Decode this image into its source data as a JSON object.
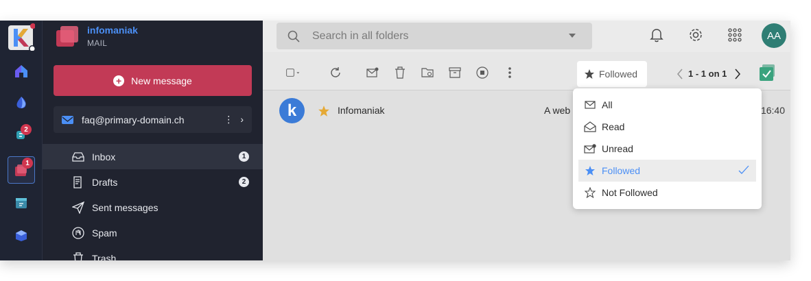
{
  "brand": {
    "name": "infomaniak",
    "product": "MAIL"
  },
  "rail": {
    "items": [
      {
        "name": "kmail-logo"
      },
      {
        "name": "home",
        "badge": ""
      },
      {
        "name": "drive",
        "badge": ""
      },
      {
        "name": "chat",
        "badge": "2"
      },
      {
        "name": "mail",
        "badge": "1"
      },
      {
        "name": "calendar",
        "badge": ""
      },
      {
        "name": "store",
        "badge": ""
      }
    ]
  },
  "sidebar": {
    "new_message_label": "New message",
    "account_email": "faq@primary-domain.ch",
    "folders": [
      {
        "label": "Inbox",
        "count": "1"
      },
      {
        "label": "Drafts",
        "count": "2"
      },
      {
        "label": "Sent messages",
        "count": ""
      },
      {
        "label": "Spam",
        "count": ""
      },
      {
        "label": "Trash",
        "count": ""
      }
    ]
  },
  "search": {
    "placeholder": "Search in all folders"
  },
  "header": {
    "avatar_initials": "AA"
  },
  "toolbar": {
    "filter_label": "Followed",
    "pagination": "1 - 1 on 1"
  },
  "messages": [
    {
      "sender": "Infomaniak",
      "preview": "A web",
      "time": "16:40",
      "starred": true
    }
  ],
  "filter_menu": {
    "items": [
      {
        "label": "All",
        "icon": "envelope-icon",
        "selected": false
      },
      {
        "label": "Read",
        "icon": "envelope-open-icon",
        "selected": false
      },
      {
        "label": "Unread",
        "icon": "envelope-unread-icon",
        "selected": false
      },
      {
        "label": "Followed",
        "icon": "star-filled-icon",
        "selected": true
      },
      {
        "label": "Not Followed",
        "icon": "star-outline-icon",
        "selected": false
      }
    ]
  },
  "colors": {
    "accent": "#c23a56",
    "link_blue": "#4b8ff5",
    "sidebar_bg": "#20232f",
    "avatar_bg": "#2f7e74",
    "star_gold": "#e5a935"
  }
}
